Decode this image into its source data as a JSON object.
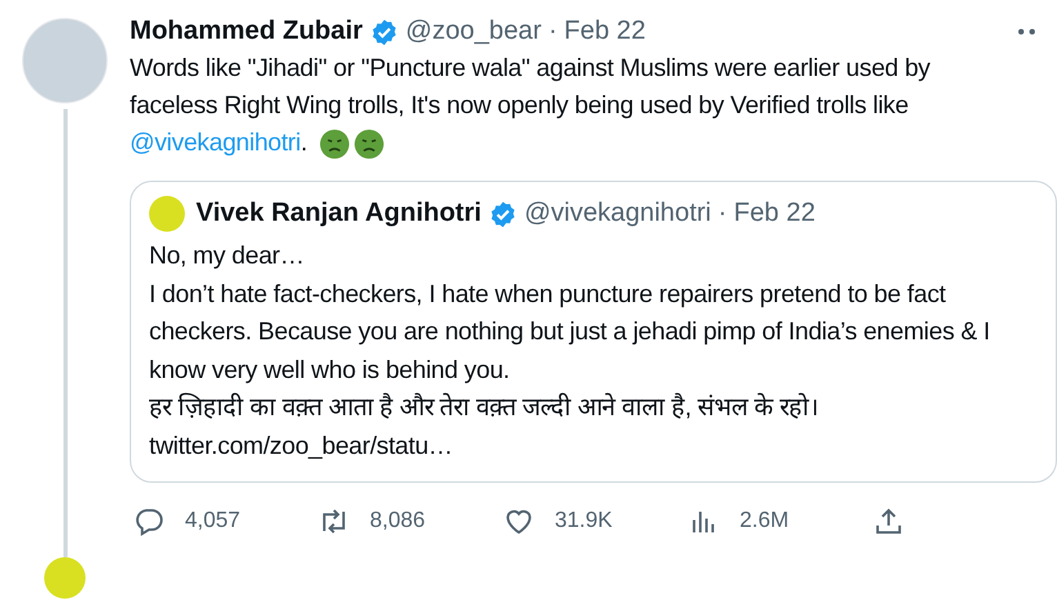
{
  "tweet": {
    "author": "Mohammed Zubair",
    "verified": true,
    "handle": "@zoo_bear",
    "separator": "·",
    "date": "Feb 22",
    "text": "Words like \"Jihadi\" or \"Puncture wala\"  against Muslims were earlier used by faceless Right Wing trolls, It's now openly being used by Verified trolls like ",
    "mention": "@vivekagnihotri",
    "text_end": ".",
    "quoted": {
      "author": "Vivek Ranjan Agnihotri",
      "verified": true,
      "handle": "@vivekagnihotri",
      "separator": "·",
      "date": "Feb 22",
      "lines": [
        "No, my dear…",
        "I don’t hate fact-checkers, I hate when puncture repairers pretend to be fact checkers. Because you are nothing but just a jehadi pimp of India’s enemies & I know very well who is behind you.",
        "हर ज़िहादी का वक़्त आता है और तेरा वक़्त जल्दी आने वाला है, संभल के रहो।"
      ],
      "link": "twitter.com/zoo_bear/statu…"
    },
    "actions": [
      {
        "kind": "reply",
        "count": "4,057"
      },
      {
        "kind": "retweet",
        "count": "8,086"
      },
      {
        "kind": "like",
        "count": "31.9K"
      },
      {
        "kind": "views",
        "count": "2.6M"
      },
      {
        "kind": "share"
      }
    ]
  }
}
